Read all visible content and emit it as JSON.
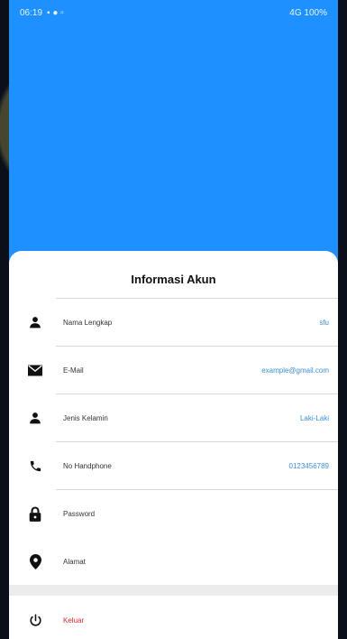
{
  "statusbar": {
    "time": "06:19",
    "right_text": "4G 100%"
  },
  "card": {
    "title": "Informasi Akun"
  },
  "rows": [
    {
      "label": "Nama Lengkap",
      "value": "sfu",
      "icon": "person-icon"
    },
    {
      "label": "E-Mail",
      "value": "example@gmail.com",
      "icon": "mail-icon"
    },
    {
      "label": "Jenis Kelamin",
      "value": "Laki-Laki",
      "icon": "person-icon"
    },
    {
      "label": "No Handphone",
      "value": "0123456789",
      "icon": "phone-icon"
    },
    {
      "label": "Password",
      "value": "",
      "icon": "lock-icon"
    },
    {
      "label": "Alamat",
      "value": "",
      "icon": "location-pin-icon"
    }
  ],
  "logout": {
    "label": "Keluar",
    "icon": "power-icon"
  },
  "colors": {
    "header_blue": "#1e90ff",
    "value_blue": "#3a8fd8",
    "logout_red": "#d82a2a"
  }
}
